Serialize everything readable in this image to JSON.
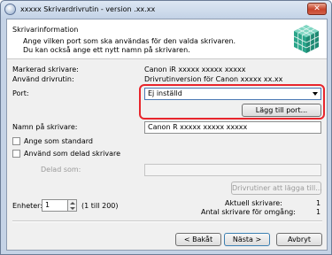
{
  "window": {
    "title": "xxxxx Skrivardrivrutin - version .xx.xx",
    "close_glyph": "✕"
  },
  "header": {
    "title": "Skrivarinformation",
    "desc1": "Ange vilken port som ska användas för den valda skrivaren.",
    "desc2": "Du kan också ange ett nytt namn på skrivaren."
  },
  "info": {
    "selected_printer_label": "Markerad skrivare:",
    "selected_printer_value": "Canon iR xxxxx xxxxx xxxxx",
    "driver_label": "Använd drivrutin:",
    "driver_value": "Drivrutinversion för Canon xxxxx xx.xx"
  },
  "port": {
    "label": "Port:",
    "selected": "Ej inställd",
    "add_port_button": "Lägg till port..."
  },
  "printer_name": {
    "label": "Namn på skrivare:",
    "value": "Canon R xxxxx xxxxx xxxxx"
  },
  "options": {
    "set_default": "Ange som standard",
    "shared": "Använd som delad skrivare",
    "share_name_label": "Delad som:",
    "share_name_value": "",
    "drivers_to_add_button": "Drivrutiner att lägga till..."
  },
  "units": {
    "label": "Enheter:",
    "value": "1",
    "range": "(1 till 200)",
    "current_printer_label": "Aktuell skrivare:",
    "current_printer_value": "1",
    "count_per_round_label": "Antal skrivare för omgång:",
    "count_per_round_value": "1"
  },
  "buttons": {
    "back": "< Bakåt",
    "next": "Nästa >",
    "cancel": "Avbryt"
  },
  "colors": {
    "highlight": "#e8252c",
    "accent_cubes": "#3bb39a"
  }
}
